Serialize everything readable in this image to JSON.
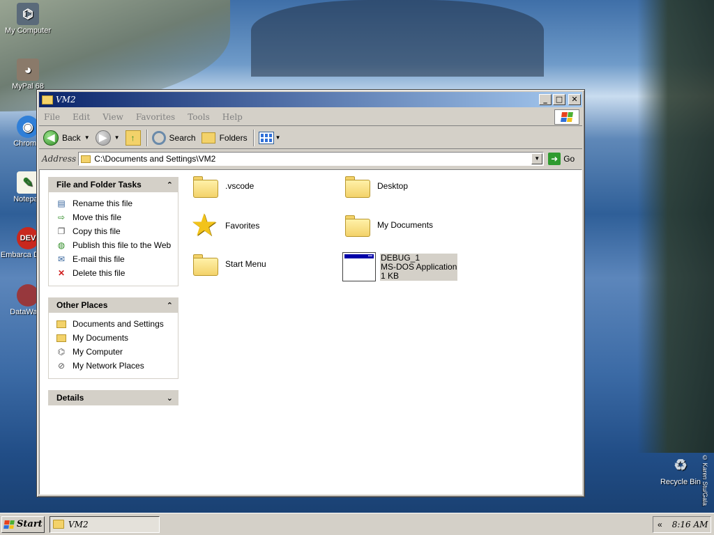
{
  "desktop": {
    "icons": [
      {
        "label": "My Computer"
      },
      {
        "label": "MyPal 68"
      },
      {
        "label": "Chromiu"
      },
      {
        "label": "Notepad"
      },
      {
        "label": "Embarca Dev-C"
      },
      {
        "label": "DataWage"
      },
      {
        "label": "Recycle Bin"
      }
    ],
    "copyright": "© Karen Stu/Gala"
  },
  "window": {
    "title": "VM2",
    "menu": [
      "File",
      "Edit",
      "View",
      "Favorites",
      "Tools",
      "Help"
    ],
    "toolbar": {
      "back": "Back",
      "search": "Search",
      "folders": "Folders"
    },
    "address": {
      "label": "Address",
      "value": "C:\\Documents and Settings\\VM2",
      "go": "Go"
    },
    "task_panels": [
      {
        "title": "File and Folder Tasks",
        "items": [
          {
            "label": "Rename this file",
            "icon": "rename-icon"
          },
          {
            "label": "Move this file",
            "icon": "move-icon"
          },
          {
            "label": "Copy this file",
            "icon": "copy-icon"
          },
          {
            "label": "Publish this file to the Web",
            "icon": "globe-icon"
          },
          {
            "label": "E-mail this file",
            "icon": "email-icon"
          },
          {
            "label": "Delete this file",
            "icon": "delete-icon"
          }
        ]
      },
      {
        "title": "Other Places",
        "items": [
          {
            "label": "Documents and Settings",
            "icon": "folder-icon"
          },
          {
            "label": "My Documents",
            "icon": "folder-icon"
          },
          {
            "label": "My Computer",
            "icon": "computer-icon"
          },
          {
            "label": "My Network Places",
            "icon": "network-icon"
          }
        ]
      },
      {
        "title": "Details",
        "items": []
      }
    ],
    "files": [
      {
        "name": ".vscode",
        "type": "folder"
      },
      {
        "name": "Desktop",
        "type": "folder"
      },
      {
        "name": "Favorites",
        "type": "favorites"
      },
      {
        "name": "My Documents",
        "type": "folder"
      },
      {
        "name": "Start Menu",
        "type": "folder"
      },
      {
        "name": "DEBUG_1",
        "type": "dos",
        "subtype": "MS-DOS Application",
        "size": "1 KB"
      }
    ]
  },
  "taskbar": {
    "start": "Start",
    "task": "VM2",
    "tray_arrow": "«",
    "clock": "8:16 AM"
  }
}
